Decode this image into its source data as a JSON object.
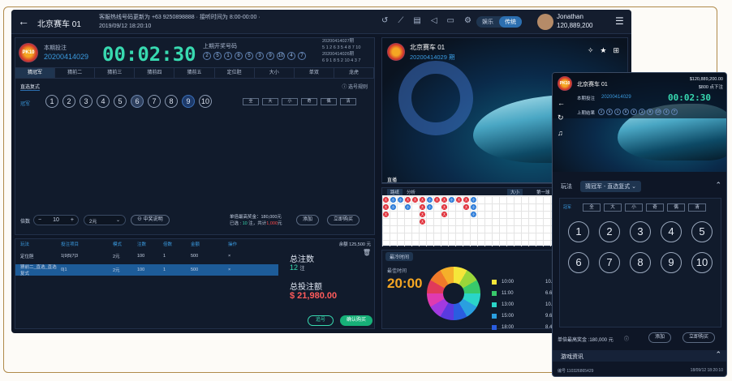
{
  "topbar": {
    "title": "北京赛车 01",
    "notice1": "客服热线号码更新为 +63 9250898888 · 接听时间为 8:00-00:00 ·",
    "datetime": "2019/09/12 18:20:10",
    "mode_a": "娱乐",
    "mode_b": "传统",
    "user_name": "Jonathan",
    "user_balance": "120,889,200"
  },
  "bet": {
    "current_label": "本期投注",
    "current_issue": "20200414029",
    "timer": "00:02:30",
    "prev_label": "上期开奖号码",
    "prev_balls": [
      "2",
      "5",
      "1",
      "8",
      "5",
      "3",
      "9",
      "10",
      "4",
      "7"
    ],
    "history": [
      "20200414027期",
      "5 1 2 6 3 5 4 8 7 10",
      "20200414026期",
      "6 9 1 8 5 2 10 4 3 7"
    ],
    "tabs": [
      "猜冠军",
      "猜前二",
      "猜前三",
      "猜前四",
      "猜前五",
      "定位胆",
      "大小",
      "单双",
      "龙虎"
    ],
    "sub_label": "直选复式",
    "rule_label": "选号规则",
    "row_label": "冠军",
    "numbers": [
      "1",
      "2",
      "3",
      "4",
      "5",
      "6",
      "7",
      "8",
      "9",
      "10"
    ],
    "filters": [
      "全",
      "大",
      "小",
      "奇",
      "偶",
      "清"
    ],
    "multiplier_label": "倍数",
    "multiplier": "10",
    "unit": "2元",
    "prize_label": "中奖说明",
    "max_win": "单倍最高奖金：180,000元",
    "selected_prefix": "已选 : ",
    "selected_bets": "10",
    "selected_mid": " 注，共计",
    "selected_amount": "1,000",
    "selected_suffix": "元",
    "add_label": "添加",
    "buy_label": "立即购买"
  },
  "order": {
    "headers": [
      "玩法",
      "投注项目",
      "模式",
      "注数",
      "倍数",
      "金额",
      "操作"
    ],
    "rows": [
      [
        "定位胆",
        "1|9|5|7|3",
        "2元",
        "100",
        "1",
        "500",
        "×"
      ],
      [
        "猜前二_直选_直选复式",
        "0|1",
        "2元",
        "100",
        "1",
        "500",
        "×"
      ]
    ],
    "balance": "余额 125,500 元",
    "count_label": "总注数",
    "count": "12",
    "count_unit": "注",
    "amount_label": "总投注额",
    "amount": "$ 21,980.00",
    "chase_label": "追号",
    "confirm_label": "确认购买"
  },
  "video": {
    "title": "北京赛车 01",
    "issue": "20200414029 期",
    "live": "直播",
    "badge1": "2",
    "badge2": "3"
  },
  "trend": {
    "tabs": [
      "路纸",
      "分析"
    ],
    "select": "大小",
    "pages": [
      "第一球",
      "第二"
    ]
  },
  "stats": {
    "select": "最冷时间",
    "today": "今日",
    "hot_label": "最佳时间",
    "hot_time": "20:00",
    "legend": [
      {
        "t": "10:00",
        "v": "10.98%",
        "c": "#f5e63a"
      },
      {
        "t": "11:00",
        "v": "6.62%",
        "c": "#38c96b"
      },
      {
        "t": "13:00",
        "v": "10.98%",
        "c": "#2ad5c8"
      },
      {
        "t": "15:00",
        "v": "9.65%",
        "c": "#2a9fe0"
      },
      {
        "t": "18:00",
        "v": "8.43%",
        "c": "#2a5de0"
      }
    ]
  },
  "mobile": {
    "title": "北京赛车 01",
    "balance": "$120,889,200.00",
    "balance2": "$800 点下注",
    "current_label": "本期投注",
    "issue": "20200414029",
    "timer": "00:02:30",
    "prev_label": "上期结果",
    "play_label": "玩法",
    "play_value": "猜冠军 - 直选复式",
    "row_label": "冠军",
    "filters": [
      "全",
      "大",
      "小",
      "奇",
      "偶",
      "清"
    ],
    "numbers": [
      "1",
      "2",
      "3",
      "4",
      "5",
      "6",
      "7",
      "8",
      "9",
      "10"
    ],
    "max_win": "单倍最高奖金 :180,000 元",
    "add_label": "添加",
    "buy_label": "立即购买",
    "info_label": "游戏资讯",
    "id_text": "编号 110326865429",
    "time_text": "18/09/12 18:20:10"
  }
}
